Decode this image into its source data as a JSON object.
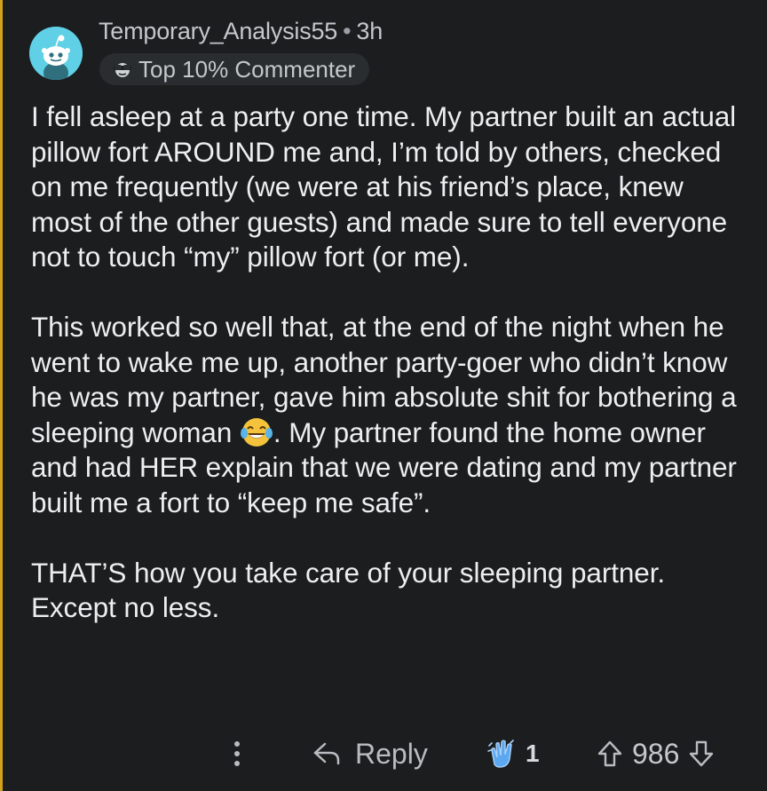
{
  "comment": {
    "username": "Temporary_Analysis55",
    "separator": "•",
    "age": "3h",
    "badge": {
      "label": "Top 10% Commenter",
      "icon": "sunglasses-face-icon"
    },
    "avatar": {
      "icon": "reddit-snoo-avatar",
      "color": "#5fd0e6"
    },
    "paragraphs": [
      "I fell asleep at a party one time. My partner built an actual pillow fort AROUND me and, I’m told by others, checked on me frequently (we were at his friend’s place, knew most of the other guests) and made sure to tell everyone not to touch “my” pillow fort (or me).",
      {
        "before_emoji": "This worked so well that, at the end of the night when he went to wake me up, another party-goer who didn’t know he was my partner, gave him absolute shit for bothering a sleeping woman ",
        "emoji": "face-with-tears-of-joy-emoji",
        "after_emoji": ". My partner found the home owner and had HER explain that we were dating and my partner built me a fort to “keep me safe”."
      },
      "THAT’S how you take care of your sleeping partner. Except no less."
    ],
    "thread_line_color": "#d4a21a"
  },
  "actions": {
    "more_icon": "vertical-ellipsis-icon",
    "reply_icon": "reply-arrow-icon",
    "reply_label": "Reply",
    "award_icon": "clapping-hands-award-icon",
    "award_count": "1",
    "upvote_icon": "upvote-arrow-icon",
    "score": "986",
    "downvote_icon": "downvote-arrow-icon"
  }
}
